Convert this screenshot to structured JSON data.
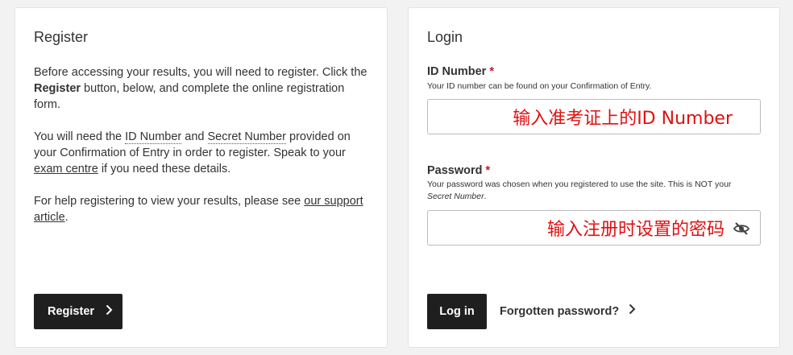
{
  "register": {
    "title": "Register",
    "p1": {
      "before": "Before accessing your results, you will need to register. Click the ",
      "bold": "Register",
      "after": " button, below, and complete the online registration form."
    },
    "p2": {
      "t1": "You will need the ",
      "id_number": "ID Number",
      "t2": " and ",
      "secret_number": "Secret Number",
      "t3": " provided on your Confirmation of Entry in order to register. Speak to your ",
      "exam_centre": "exam centre",
      "t4": " if you need these details."
    },
    "p3": {
      "t1": "For help registering to view your results, please see ",
      "link": "our support article",
      "t2": "."
    },
    "button_label": "Register"
  },
  "login": {
    "title": "Login",
    "id_label": "ID Number",
    "required_mark": "*",
    "id_hint": "Your ID number can be found on your Confirmation of Entry.",
    "id_input_value": "输入准考证上的ID Number",
    "password_label": "Password",
    "password_hint_before": "Your password was chosen when you registered to use the site. This is NOT your ",
    "password_hint_italic": "Secret Number",
    "password_hint_after": ".",
    "password_input_value": "输入注册时设置的密码",
    "login_button": "Log in",
    "forgot_link": "Forgotten password?"
  },
  "icons": {
    "chevron": "chevron-right-icon",
    "eye": "eye-slash-icon"
  }
}
